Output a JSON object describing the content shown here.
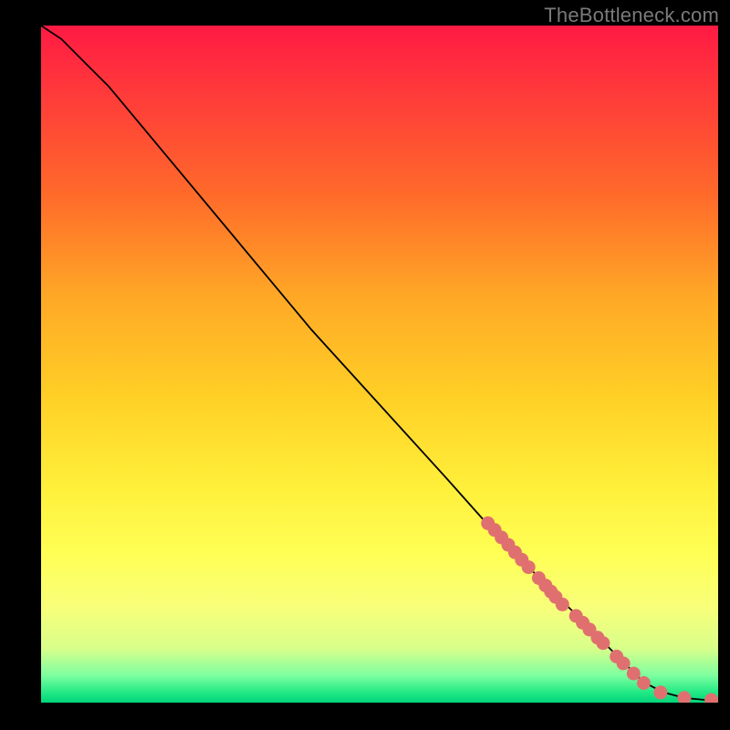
{
  "attribution": "TheBottleneck.com",
  "chart_data": {
    "type": "line",
    "title": "",
    "xlabel": "",
    "ylabel": "",
    "xlim": [
      0,
      100
    ],
    "ylim": [
      0,
      100
    ],
    "series": [
      {
        "name": "curve",
        "x": [
          0,
          3,
          6,
          10,
          20,
          30,
          40,
          50,
          60,
          68,
          74,
          80,
          85,
          89,
          92,
          95,
          98,
          100
        ],
        "y": [
          100,
          98,
          95,
          91,
          79,
          67,
          55,
          44,
          33,
          24,
          18,
          12,
          7,
          3,
          1.5,
          0.7,
          0.4,
          0.3
        ]
      }
    ],
    "marker_points": [
      {
        "x": 66,
        "y": 26.5
      },
      {
        "x": 67,
        "y": 25.5
      },
      {
        "x": 68,
        "y": 24.4
      },
      {
        "x": 69,
        "y": 23.3
      },
      {
        "x": 70,
        "y": 22.2
      },
      {
        "x": 71,
        "y": 21.1
      },
      {
        "x": 72,
        "y": 20.0
      },
      {
        "x": 73.5,
        "y": 18.4
      },
      {
        "x": 74.5,
        "y": 17.3
      },
      {
        "x": 75.3,
        "y": 16.4
      },
      {
        "x": 76.0,
        "y": 15.6
      },
      {
        "x": 77.0,
        "y": 14.5
      },
      {
        "x": 79.0,
        "y": 12.8
      },
      {
        "x": 80.0,
        "y": 11.8
      },
      {
        "x": 81.0,
        "y": 10.8
      },
      {
        "x": 82.2,
        "y": 9.6
      },
      {
        "x": 83.0,
        "y": 8.8
      },
      {
        "x": 85.0,
        "y": 6.8
      },
      {
        "x": 86.0,
        "y": 5.8
      },
      {
        "x": 87.5,
        "y": 4.3
      },
      {
        "x": 89.0,
        "y": 2.9
      },
      {
        "x": 91.5,
        "y": 1.5
      },
      {
        "x": 95.0,
        "y": 0.7
      },
      {
        "x": 99.0,
        "y": 0.4
      }
    ],
    "marker_color": "#e07070",
    "gradient_stops": [
      {
        "pos": 0,
        "color": "#ff1a44"
      },
      {
        "pos": 0.55,
        "color": "#ffd026"
      },
      {
        "pos": 0.78,
        "color": "#ffff55"
      },
      {
        "pos": 1.0,
        "color": "#00d47a"
      }
    ]
  }
}
